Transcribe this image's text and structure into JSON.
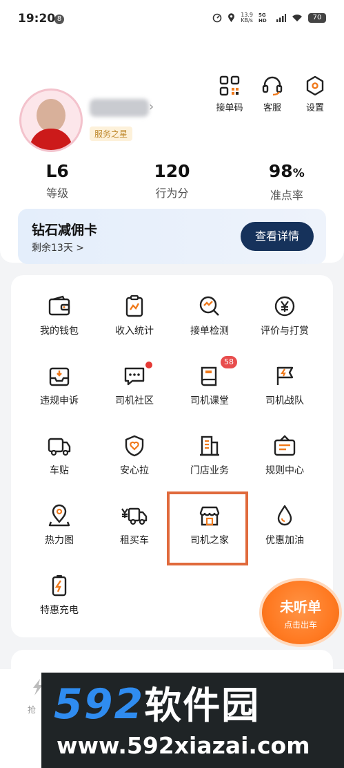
{
  "status_bar": {
    "time": "19:20",
    "notification_badge": "8",
    "net_speed_value": "13.9",
    "net_speed_unit": "KB/s",
    "network_type": "5G HD",
    "battery": "70"
  },
  "top_actions": [
    {
      "label": "接单码",
      "icon": "qr-code-icon"
    },
    {
      "label": "客服",
      "icon": "headset-icon"
    },
    {
      "label": "设置",
      "icon": "settings-hexagon-icon"
    }
  ],
  "profile": {
    "badge": "服务之星"
  },
  "stats": [
    {
      "value": "L6",
      "unit": "",
      "label": "等级"
    },
    {
      "value": "120",
      "unit": "",
      "label": "行为分"
    },
    {
      "value": "98",
      "unit": "%",
      "label": "准点率"
    }
  ],
  "commission_card": {
    "title": "钻石减佣卡",
    "remaining": "剩余13天 >",
    "button": "查看详情"
  },
  "grid": [
    {
      "label": "我的钱包",
      "icon": "wallet-icon"
    },
    {
      "label": "收入统计",
      "icon": "income-chart-icon"
    },
    {
      "label": "接单检测",
      "icon": "order-check-icon"
    },
    {
      "label": "评价与打赏",
      "icon": "yen-coin-icon"
    },
    {
      "label": "违规申诉",
      "icon": "appeal-tray-icon"
    },
    {
      "label": "司机社区",
      "icon": "chat-bubble-icon"
    },
    {
      "label": "司机课堂",
      "icon": "book-icon",
      "badge": "58"
    },
    {
      "label": "司机战队",
      "icon": "flag-bolt-icon"
    },
    {
      "label": "车贴",
      "icon": "truck-icon"
    },
    {
      "label": "安心拉",
      "icon": "heart-shield-icon"
    },
    {
      "label": "门店业务",
      "icon": "building-icon"
    },
    {
      "label": "规则中心",
      "icon": "rule-sign-icon"
    },
    {
      "label": "热力图",
      "icon": "map-pin-icon"
    },
    {
      "label": "租买车",
      "icon": "yen-truck-icon"
    },
    {
      "label": "司机之家",
      "icon": "store-icon"
    },
    {
      "label": "优惠加油",
      "icon": "oil-drop-icon"
    },
    {
      "label": "特惠充电",
      "icon": "battery-charge-icon"
    }
  ],
  "listen_button": {
    "title": "未听单",
    "subtitle": "点击出车"
  },
  "bottom_nav": {
    "left_label": "抢"
  },
  "watermark": {
    "number": "592",
    "brand": "软件园",
    "url": "www.592xiazai.com"
  },
  "colors": {
    "accent_navy": "#16325b",
    "highlight_orange": "#e06a3c",
    "listen_orange": "#ff7a22",
    "badge_red": "#e53935",
    "watermark_blue": "#2f8cf0"
  }
}
